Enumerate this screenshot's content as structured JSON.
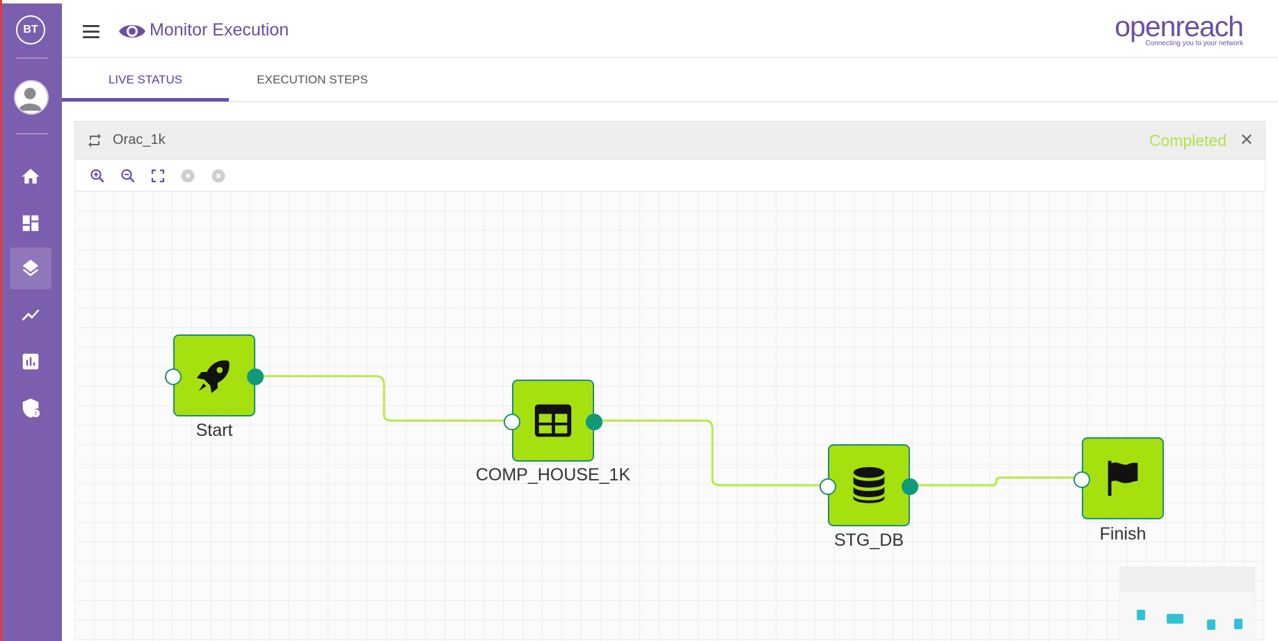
{
  "sidebar": {
    "logo": "BT",
    "items": [
      {
        "icon": "home-icon"
      },
      {
        "icon": "dashboard-icon"
      },
      {
        "icon": "layers-icon",
        "active": true
      },
      {
        "icon": "trend-line-icon"
      },
      {
        "icon": "bar-chart-icon"
      },
      {
        "icon": "security-shield-icon"
      }
    ]
  },
  "header": {
    "title": "Monitor Execution",
    "brand_name": "openreach",
    "brand_tagline": "Connecting you to your network"
  },
  "tabs": [
    {
      "label": "LIVE STATUS",
      "active": true
    },
    {
      "label": "EXECUTION STEPS",
      "active": false
    }
  ],
  "execution": {
    "name": "Orac_1k",
    "status": "Completed",
    "status_color": "#b3e04a"
  },
  "toolbar": [
    "zoom-in-icon",
    "zoom-out-icon",
    "fit-screen-icon",
    "play-icon",
    "stop-icon"
  ],
  "workflow": {
    "node_color": "#a6e00f",
    "border_color": "#1a8f72",
    "wire_color": "#b8e84a",
    "nodes": [
      {
        "label": "Start",
        "icon": "rocket-icon"
      },
      {
        "label": "COMP_HOUSE_1K",
        "icon": "table-icon"
      },
      {
        "label": "STG_DB",
        "icon": "database-icon"
      },
      {
        "label": "Finish",
        "icon": "flag-icon"
      }
    ]
  }
}
